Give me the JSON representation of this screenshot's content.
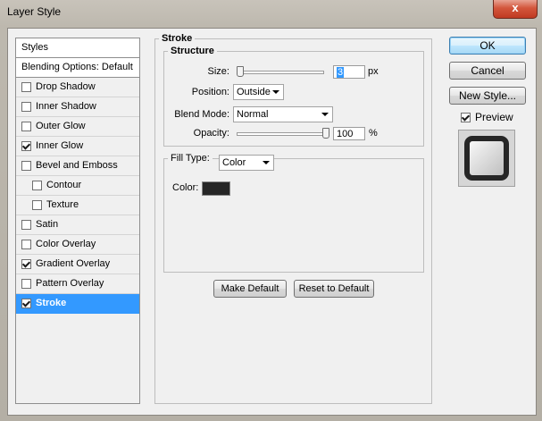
{
  "window": {
    "title": "Layer Style",
    "close_glyph": "x"
  },
  "styles_list": {
    "header": "Styles",
    "blending": "Blending Options: Default",
    "items": [
      {
        "label": "Drop Shadow",
        "checked": false,
        "sub": false,
        "active": false
      },
      {
        "label": "Inner Shadow",
        "checked": false,
        "sub": false,
        "active": false
      },
      {
        "label": "Outer Glow",
        "checked": false,
        "sub": false,
        "active": false
      },
      {
        "label": "Inner Glow",
        "checked": true,
        "sub": false,
        "active": false
      },
      {
        "label": "Bevel and Emboss",
        "checked": false,
        "sub": false,
        "active": false
      },
      {
        "label": "Contour",
        "checked": false,
        "sub": true,
        "active": false
      },
      {
        "label": "Texture",
        "checked": false,
        "sub": true,
        "active": false
      },
      {
        "label": "Satin",
        "checked": false,
        "sub": false,
        "active": false
      },
      {
        "label": "Color Overlay",
        "checked": false,
        "sub": false,
        "active": false
      },
      {
        "label": "Gradient Overlay",
        "checked": true,
        "sub": false,
        "active": false
      },
      {
        "label": "Pattern Overlay",
        "checked": false,
        "sub": false,
        "active": false
      },
      {
        "label": "Stroke",
        "checked": true,
        "sub": false,
        "active": true
      }
    ]
  },
  "stroke": {
    "group_title": "Stroke",
    "structure_title": "Structure",
    "size_label": "Size:",
    "size_value": "3",
    "size_unit": "px",
    "size_fraction": 0.03,
    "position_label": "Position:",
    "position_value": "Outside",
    "blend_label": "Blend Mode:",
    "blend_value": "Normal",
    "opacity_label": "Opacity:",
    "opacity_value": "100",
    "opacity_unit": "%",
    "opacity_fraction": 1.0,
    "fill_type_label": "Fill Type:",
    "fill_type_value": "Color",
    "color_label": "Color:",
    "color_value": "#262626",
    "make_default": "Make Default",
    "reset_default": "Reset to Default"
  },
  "buttons": {
    "ok": "OK",
    "cancel": "Cancel",
    "new_style": "New Style...",
    "preview_label": "Preview",
    "preview_checked": true
  }
}
